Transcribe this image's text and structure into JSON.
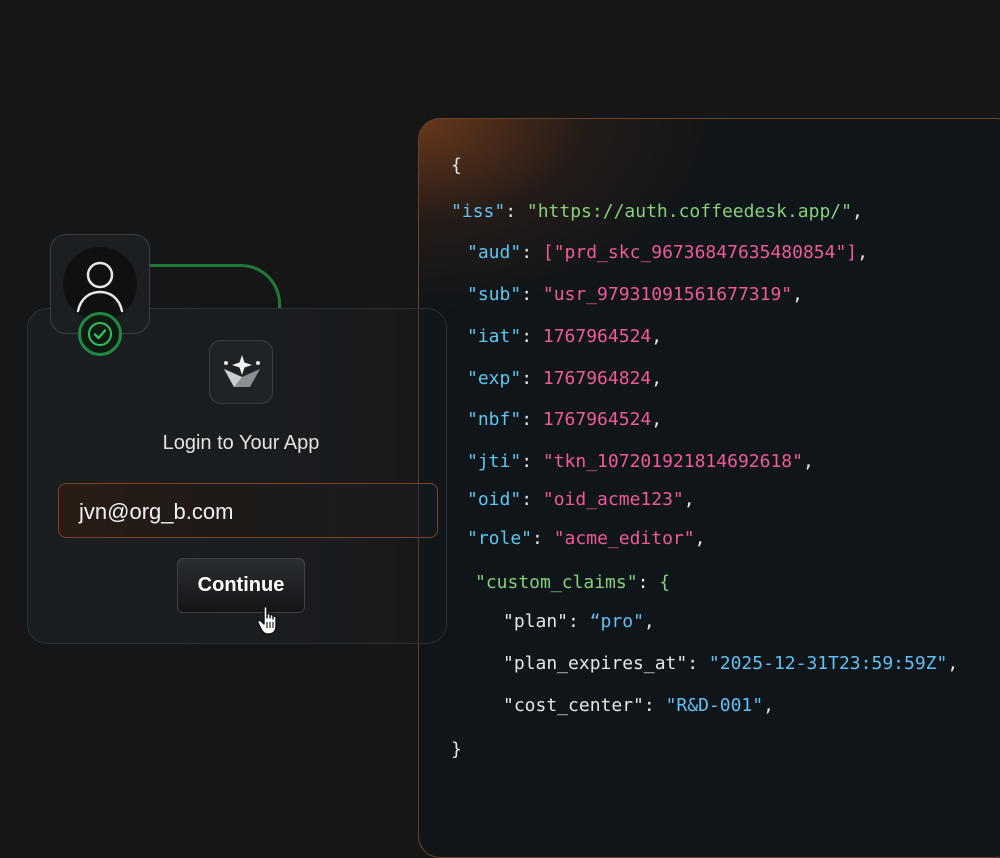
{
  "login": {
    "title": "Login to Your App",
    "email_value": "jvn@org_b.com",
    "continue_label": "Continue"
  },
  "token": {
    "open_brace": "{",
    "close_brace": "}",
    "lines": [
      {
        "key": "\"iss\"",
        "value": "\"https://auth.coffeedesk.app/\"",
        "suffix": ","
      },
      {
        "key": "\"aud\"",
        "value": "[\"prd_skc_96736847635480854\"]",
        "suffix": ","
      },
      {
        "key": "\"sub\"",
        "value": "\"usr_97931091561677319\"",
        "suffix": ","
      },
      {
        "key": "\"iat\"",
        "value": "1767964524",
        "suffix": ","
      },
      {
        "key": "\"exp\"",
        "value": "1767964824",
        "suffix": ","
      },
      {
        "key": "\"nbf\"",
        "value": "1767964524",
        "suffix": ","
      },
      {
        "key": "\"jti\"",
        "value": "\"tkn_107201921814692618\"",
        "suffix": ","
      },
      {
        "key": "\"oid\"",
        "value": "\"oid_acme123\"",
        "suffix": ","
      },
      {
        "key": "\"role\"",
        "value": "\"acme_editor\"",
        "suffix": ","
      }
    ],
    "custom_claims_key": "\"custom_claims\"",
    "custom_claims_open": "{",
    "claims": [
      {
        "key": "\"plan\"",
        "value": "“pro\"",
        "suffix": ","
      },
      {
        "key": "\"plan_expires_at\"",
        "value": "\"2025-12-31T23:59:59Z\"",
        "suffix": ","
      },
      {
        "key": "\"cost_center\"",
        "value": "\"R&D-001\"",
        "suffix": ","
      }
    ]
  },
  "colors": {
    "background": "#161616",
    "accent_green": "#1f8a44",
    "key_blue": "#5cc8f0",
    "value_pink": "#f05a9a",
    "value_green": "#86d07a"
  },
  "icons": [
    "user-icon",
    "check-icon",
    "app-logo-icon",
    "pointer-hand-icon"
  ]
}
